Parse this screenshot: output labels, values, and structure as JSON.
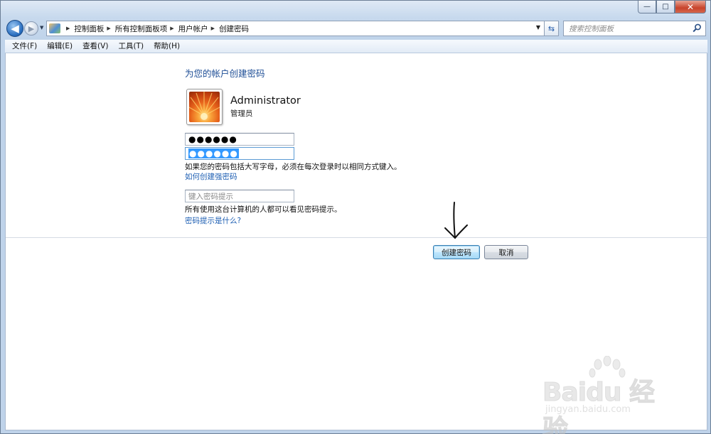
{
  "window": {
    "controls": {
      "minimize": "—",
      "maximize": "□",
      "close": "✕"
    }
  },
  "nav": {
    "back_icon": "back-arrow-icon",
    "forward_icon": "forward-arrow-icon",
    "breadcrumbs": [
      "控制面板",
      "所有控制面板项",
      "用户帐户",
      "创建密码"
    ],
    "search_placeholder": "搜索控制面板"
  },
  "menu": [
    "文件(F)",
    "编辑(E)",
    "查看(V)",
    "工具(T)",
    "帮助(H)"
  ],
  "main": {
    "title": "为您的帐户创建密码",
    "user_name": "Administrator",
    "user_role": "管理员",
    "password_value": "●●●●●●",
    "confirm_value": "●●●●●●",
    "caps_note": "如果您的密码包括大写字母，必须在每次登录时以相同方式键入。",
    "strong_pw_link": "如何创建强密码",
    "hint_placeholder": "键入密码提示",
    "hint_note": "所有使用这台计算机的人都可以看见密码提示。",
    "hint_link": "密码提示是什么?",
    "create_button": "创建密码",
    "cancel_button": "取消"
  },
  "watermark": {
    "brand": "Baidu 经验",
    "url": "jingyan.baidu.com"
  },
  "colors": {
    "title_blue": "#1e4e96",
    "link_blue": "#1e5fb3",
    "selection": "#3399ff"
  }
}
